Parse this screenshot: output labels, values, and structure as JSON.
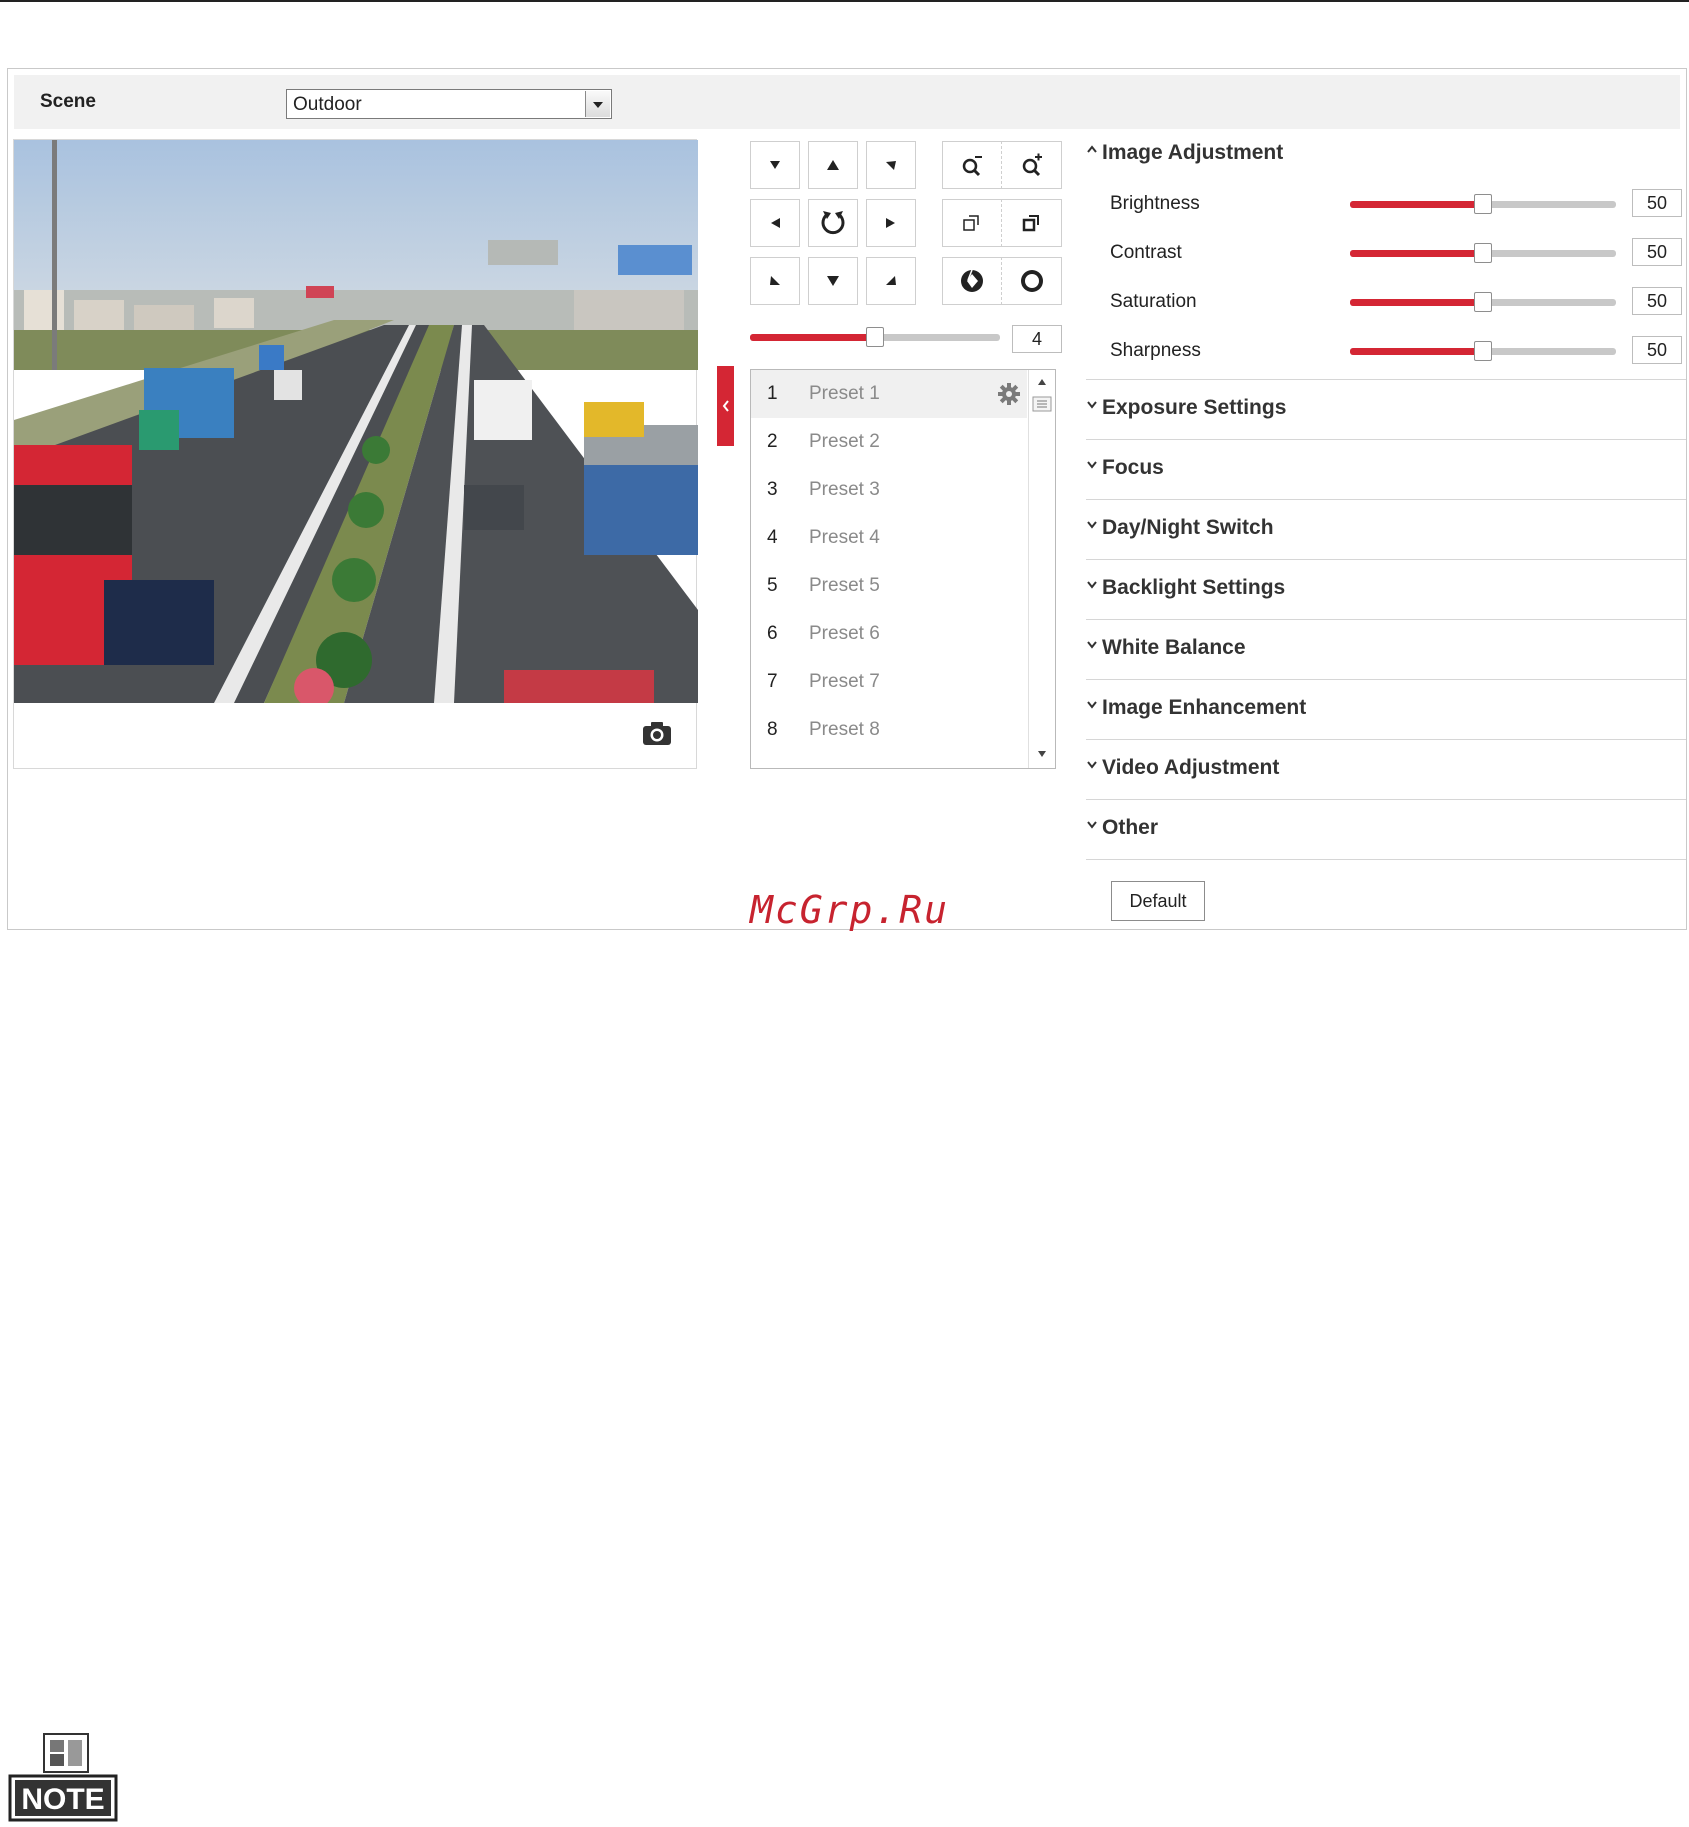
{
  "scene": {
    "label": "Scene",
    "value": "Outdoor"
  },
  "ptz": {
    "speed": {
      "value": "4",
      "level_fraction": 0.5
    }
  },
  "presets": [
    {
      "num": "1",
      "name": "Preset 1"
    },
    {
      "num": "2",
      "name": "Preset 2"
    },
    {
      "num": "3",
      "name": "Preset 3"
    },
    {
      "num": "4",
      "name": "Preset 4"
    },
    {
      "num": "5",
      "name": "Preset 5"
    },
    {
      "num": "6",
      "name": "Preset 6"
    },
    {
      "num": "7",
      "name": "Preset 7"
    },
    {
      "num": "8",
      "name": "Preset 8"
    }
  ],
  "image_adjustment": {
    "title": "Image Adjustment",
    "params": [
      {
        "label": "Brightness",
        "value": "50",
        "level_fraction": 0.5
      },
      {
        "label": "Contrast",
        "value": "50",
        "level_fraction": 0.5
      },
      {
        "label": "Saturation",
        "value": "50",
        "level_fraction": 0.5
      },
      {
        "label": "Sharpness",
        "value": "50",
        "level_fraction": 0.5
      }
    ]
  },
  "sections": [
    "Exposure Settings",
    "Focus",
    "Day/Night Switch",
    "Backlight Settings",
    "White Balance",
    "Image Enhancement",
    "Video Adjustment",
    "Other"
  ],
  "default_button": "Default",
  "watermark": "McGrp.Ru",
  "note_label": "NOTE",
  "colors": {
    "accent": "#d42634",
    "track": "#c8c8c8",
    "border": "#c9c9c9",
    "scene_bar": "#f1f1f1"
  },
  "icons": {
    "ptz": [
      "ptz-up-left-icon",
      "ptz-up-icon",
      "ptz-up-right-icon",
      "ptz-left-icon",
      "ptz-auto-rotate-icon",
      "ptz-right-icon",
      "ptz-down-left-icon",
      "ptz-down-icon",
      "ptz-down-right-icon"
    ],
    "lens": [
      "zoom-out-icon",
      "zoom-in-icon",
      "focus-near-icon",
      "focus-far-icon",
      "iris-close-icon",
      "iris-open-icon"
    ]
  }
}
